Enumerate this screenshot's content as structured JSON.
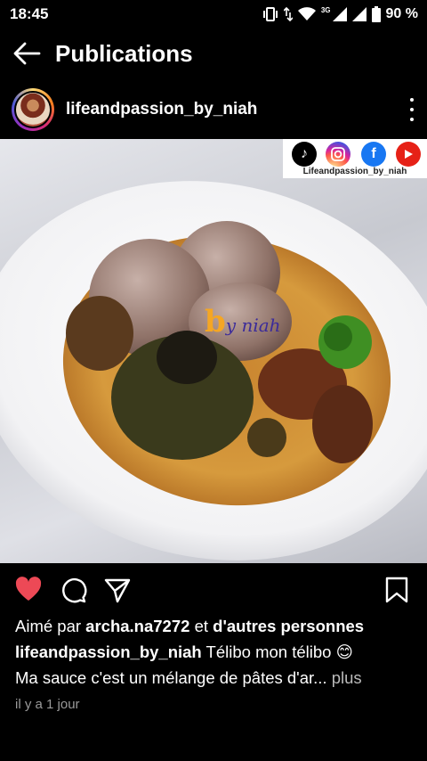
{
  "status_bar": {
    "time": "18:45",
    "network_label": "3G",
    "battery": "90 %"
  },
  "app_bar": {
    "title": "Publications"
  },
  "post": {
    "username": "lifeandpassion_by_niah",
    "image": {
      "banner_handle": "Lifeandpassion_by_niah",
      "social_icons": [
        "tiktok-icon",
        "instagram-icon",
        "facebook-icon",
        "youtube-icon"
      ],
      "watermark_letter": "b",
      "watermark_text": "y niah"
    },
    "liked": true,
    "like_color": "#ed4956",
    "likes": {
      "prefix": "Aimé par",
      "user": "archa.na7272",
      "middle": "et",
      "suffix": "d'autres personnes"
    },
    "caption": {
      "author": "lifeandpassion_by_niah",
      "text": "Télibo mon télibo 😊",
      "line2": "Ma sauce c'est un mélange de pâtes d'ar...",
      "more": "plus"
    },
    "timestamp": "il y a 1 jour"
  }
}
